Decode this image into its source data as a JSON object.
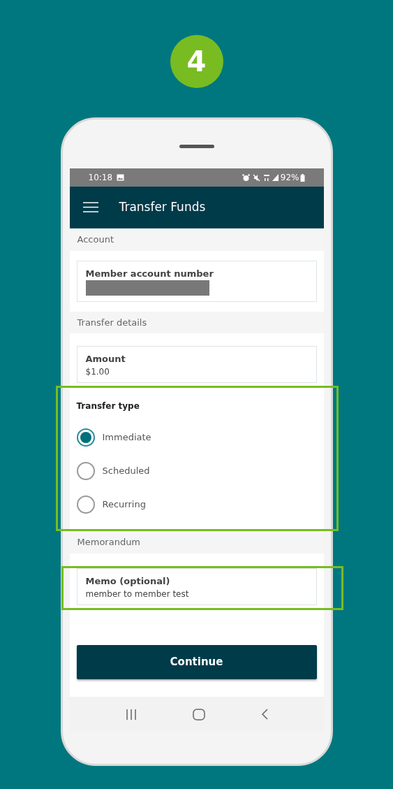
{
  "step_badge": "4",
  "status_bar": {
    "time": "10:18",
    "battery": "92%"
  },
  "app_bar": {
    "title": "Transfer Funds"
  },
  "account": {
    "header": "Account",
    "field": {
      "label": "Member account number",
      "redacted": true
    }
  },
  "transfer_details": {
    "header": "Transfer details",
    "amount": {
      "label": "Amount",
      "value": "$1.00"
    },
    "transfer_type": {
      "label": "Transfer type",
      "highlighted": true,
      "options": [
        {
          "label": "Immediate",
          "selected": true
        },
        {
          "label": "Scheduled",
          "selected": false
        },
        {
          "label": "Recurring",
          "selected": false
        }
      ]
    }
  },
  "memorandum": {
    "header": "Memorandum",
    "memo": {
      "label": "Memo (optional)",
      "value": "member to member test",
      "highlighted": true
    }
  },
  "continue_button": "Continue"
}
